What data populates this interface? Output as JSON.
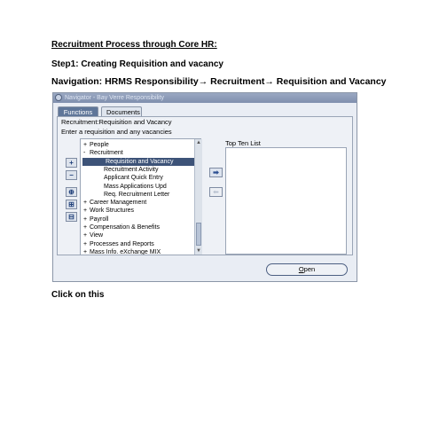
{
  "doc": {
    "title": "Recruitment Process through Core HR:",
    "step": "Step1: Creating Requisition and vacancy",
    "nav_prefix": "Navigation: HRMS Responsibility",
    "nav_recruitment": " Recruitment",
    "nav_req": " Requisition and Vacancy",
    "click_text": "Click on this"
  },
  "window": {
    "title": "Navigator - Bay Verre Responsibility",
    "tabs": [
      {
        "label": "Functions",
        "active": true
      },
      {
        "label": "Documents",
        "active": false
      }
    ],
    "panel_title": "Recruitment:Requisition and Vacancy",
    "instruction": "Enter a requisition and any vacancies",
    "tree": [
      {
        "prefix": "+",
        "label": "People",
        "indent": 0
      },
      {
        "prefix": "-",
        "label": "Recruitment",
        "indent": 0
      },
      {
        "prefix": "",
        "label": "Requisition and Vacancy",
        "indent": 2,
        "selected": true
      },
      {
        "prefix": "",
        "label": "Recruitment Activity",
        "indent": 2
      },
      {
        "prefix": "",
        "label": "Applicant Quick Entry",
        "indent": 2
      },
      {
        "prefix": "",
        "label": "Mass Applications Upd",
        "indent": 2
      },
      {
        "prefix": "",
        "label": "Req. Recruitment Letter",
        "indent": 2
      },
      {
        "prefix": "+",
        "label": "Career Management",
        "indent": 0
      },
      {
        "prefix": "+",
        "label": "Work Structures",
        "indent": 0
      },
      {
        "prefix": "+",
        "label": "Payroll",
        "indent": 0
      },
      {
        "prefix": "+",
        "label": "Compensation & Benefits",
        "indent": 0
      },
      {
        "prefix": "+",
        "label": "View",
        "indent": 0
      },
      {
        "prefix": "+",
        "label": "Processes and Reports",
        "indent": 0
      },
      {
        "prefix": "+",
        "label": "Mass Info. eXchange MIX",
        "indent": 0
      }
    ],
    "top_ten_label": "Top Ten List",
    "open_button_first": "O",
    "open_button_rest": "pen",
    "side_buttons": [
      "+",
      "−",
      "⊕",
      "⊞",
      "⊟"
    ],
    "add_glyph": "➡",
    "remove_glyph": "⬅"
  }
}
